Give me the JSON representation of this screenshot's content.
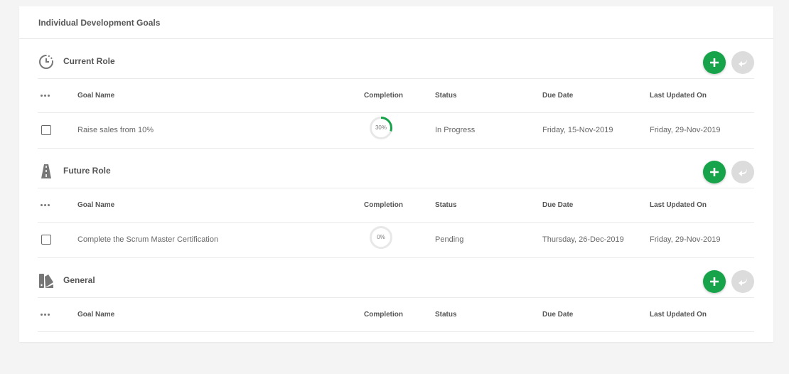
{
  "card": {
    "title": "Individual Development Goals"
  },
  "columns": {
    "name": "Goal Name",
    "completion": "Completion",
    "status": "Status",
    "due": "Due Date",
    "updated": "Last Updated On"
  },
  "colors": {
    "accent_green": "#16a34a",
    "progress_track": "#e8e8e8",
    "disabled_button": "#dcdcdc"
  },
  "sections": [
    {
      "title": "Current Role",
      "icon": "clock-history-icon",
      "goals": [
        {
          "name": "Raise sales from 10%",
          "completion": 0.3,
          "completion_label": "30%",
          "status": "In Progress",
          "due": "Friday, 15-Nov-2019",
          "updated": "Friday, 29-Nov-2019"
        }
      ]
    },
    {
      "title": "Future Role",
      "icon": "road-icon",
      "goals": [
        {
          "name": "Complete the Scrum Master Certification",
          "completion": 0,
          "completion_label": "0%",
          "status": "Pending",
          "due": "Thursday, 26-Dec-2019",
          "updated": "Friday, 29-Nov-2019"
        }
      ]
    },
    {
      "title": "General",
      "icon": "swatch-icon",
      "goals": []
    }
  ]
}
